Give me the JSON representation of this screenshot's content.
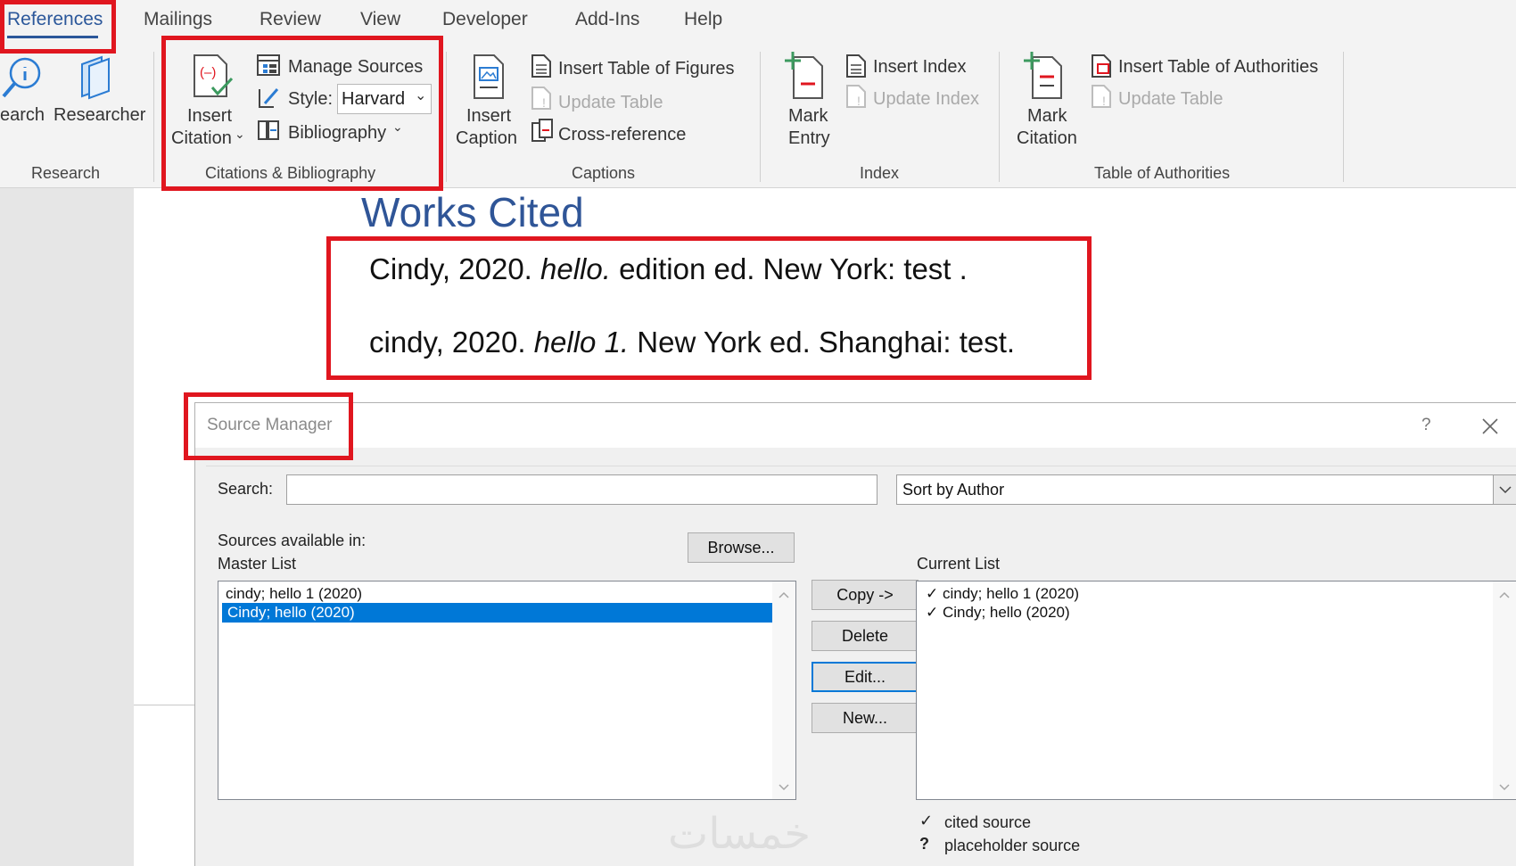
{
  "ribbon_tabs": [
    "References",
    "Mailings",
    "Review",
    "View",
    "Developer",
    "Add-Ins",
    "Help"
  ],
  "research": {
    "search_label": "earch",
    "researcher_label": "Researcher",
    "group_name": "Research"
  },
  "citations": {
    "insert_citation_line1": "Insert",
    "insert_citation_line2": "Citation",
    "manage_sources": "Manage Sources",
    "style_label": "Style:",
    "style_value": "Harvard",
    "bibliography": "Bibliography",
    "group_name": "Citations & Bibliography"
  },
  "captions": {
    "insert_caption_line1": "Insert",
    "insert_caption_line2": "Caption",
    "insert_table_of_figures": "Insert Table of Figures",
    "update_table": "Update Table",
    "cross_reference": "Cross-reference",
    "group_name": "Captions"
  },
  "index": {
    "mark_entry_line1": "Mark",
    "mark_entry_line2": "Entry",
    "insert_index": "Insert Index",
    "update_index": "Update Index",
    "group_name": "Index"
  },
  "authorities": {
    "mark_citation_line1": "Mark",
    "mark_citation_line2": "Citation",
    "insert_table_of_authorities": "Insert Table of Authorities",
    "update_table": "Update Table",
    "group_name": "Table of Authorities"
  },
  "document": {
    "heading": "Works Cited",
    "entries": [
      {
        "before": "Cindy, 2020. ",
        "title": "hello.",
        "after": " edition ed. New York: test ."
      },
      {
        "before": "cindy, 2020. ",
        "title": "hello 1.",
        "after": " New York ed. Shanghai: test."
      }
    ]
  },
  "source_manager": {
    "title": "Source Manager",
    "help_glyph": "?",
    "search_label": "Search:",
    "search_value": "",
    "sort_value": "Sort by Author",
    "sources_available_in": "Sources available in:",
    "master_list_label": "Master List",
    "browse_button": "Browse...",
    "master_list_items": [
      "cindy; hello 1 (2020)",
      "Cindy; hello (2020)"
    ],
    "master_selected_index": 1,
    "copy_button": "Copy ->",
    "delete_button": "Delete",
    "edit_button": "Edit...",
    "new_button": "New...",
    "current_list_label": "Current List",
    "current_list_items": [
      "cindy; hello 1 (2020)",
      "Cindy; hello (2020)"
    ],
    "legend_cited_glyph": "✓",
    "legend_cited": "cited source",
    "legend_placeholder_glyph": "?",
    "legend_placeholder": "placeholder source"
  },
  "watermark": "خمسات",
  "colors": {
    "highlight_red": "#e0161f",
    "heading_blue": "#2f5597",
    "selection_blue": "#0078d7",
    "ribbon_bg": "#f3f3f3",
    "active_tab_underline": "#2b579a"
  }
}
